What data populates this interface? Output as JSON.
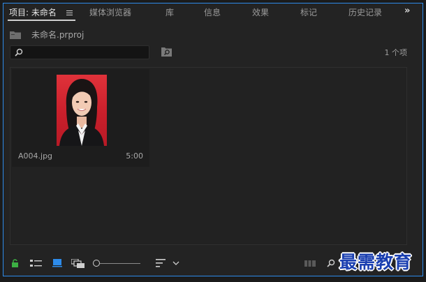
{
  "tabs": [
    {
      "label": "项目: 未命名",
      "active": true
    },
    {
      "label": "媒体浏览器"
    },
    {
      "label": "库"
    },
    {
      "label": "信息"
    },
    {
      "label": "效果"
    },
    {
      "label": "标记"
    },
    {
      "label": "历史记录"
    }
  ],
  "overflow_glyph": "»",
  "project": {
    "name": "未命名.prproj"
  },
  "search": {
    "value": "",
    "placeholder": ""
  },
  "item_count": "1 个项",
  "clips": [
    {
      "name": "A004.jpg",
      "duration": "5:00"
    }
  ],
  "watermark": "最需教育",
  "colors": {
    "accent": "#2d8ceb",
    "panel": "#232323",
    "lock_icon": "#3cb043",
    "thumbnail_bg": "#d82a34",
    "watermark": "#1a3fb0"
  },
  "icons": {
    "toolbar": [
      "unlock-icon",
      "list-view-icon",
      "icon-view-icon",
      "freeform-view-icon",
      "zoom-slider",
      "sort-icon",
      "chevron-down-icon",
      "automate-sequence-icon",
      "find-icon"
    ]
  }
}
